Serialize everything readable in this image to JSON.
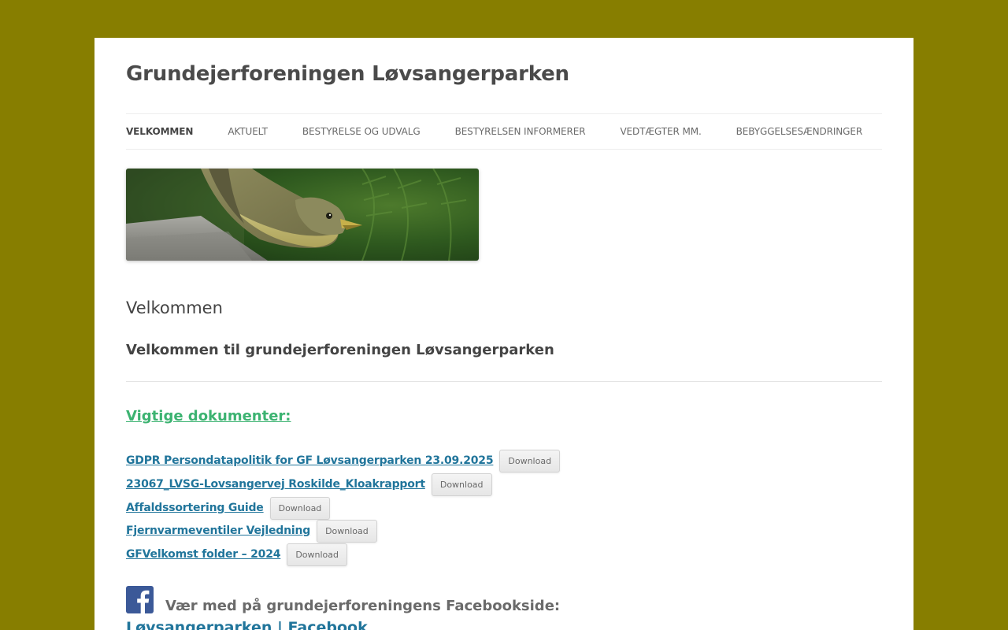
{
  "site": {
    "title": "Grundejerforeningen Løvsangerparken"
  },
  "nav": {
    "items": [
      {
        "label": "Velkommen",
        "current": true
      },
      {
        "label": "Aktuelt"
      },
      {
        "label": "Bestyrelse og udvalg"
      },
      {
        "label": "Bestyrelsen informerer"
      },
      {
        "label": "Vedtægter mm."
      },
      {
        "label": "Bebyggelsesændringer"
      }
    ]
  },
  "header_image": {
    "alt": "bird-photo"
  },
  "content": {
    "entry_title": "Velkommen",
    "welcome_heading": "Velkommen til grundejerforeningen Løvsangerparken",
    "docs_heading": "Vigtige dokumenter:",
    "documents": [
      {
        "title": "GDPR Persondatapolitik for GF Løvsangerparken 23.09.2025",
        "button": "Download"
      },
      {
        "title": "23067_LVSG-Lovsangervej Roskilde_Kloakrapport",
        "button": "Download"
      },
      {
        "title": "Affaldssortering Guide",
        "button": "Download"
      },
      {
        "title": "Fjernvarmeventiler Vejledning",
        "button": "Download"
      },
      {
        "title": "GFVelkomst folder – 2024",
        "button": "Download"
      }
    ],
    "facebook_text": "Vær med på grundejerforeningens Facebookside:",
    "facebook_link": "Løvsangerparken | Facebook"
  },
  "colors": {
    "background": "#877e00",
    "link": "#21759b",
    "docs_heading": "#3cb371",
    "facebook_blue": "#3b5998"
  },
  "icons": {
    "facebook": "facebook-icon"
  }
}
